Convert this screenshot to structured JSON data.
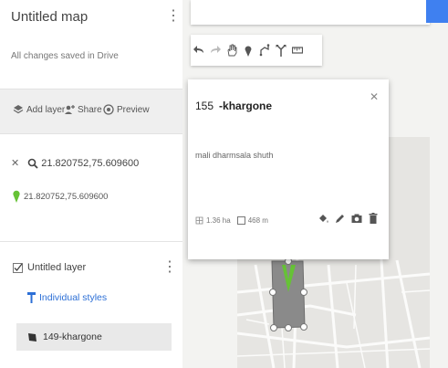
{
  "map": {
    "title": "Untitled map",
    "saved_status": "All changes saved in Drive"
  },
  "toolbar": {
    "add_layer": "Add layer",
    "share": "Share",
    "preview": "Preview"
  },
  "search_result": {
    "query": "21.820752,75.609600",
    "pin_label": "21.820752,75.609600"
  },
  "layer": {
    "title": "Untitled layer",
    "styles_link": "Individual styles",
    "feature": "149-khargone"
  },
  "info_card": {
    "number": "155",
    "name": "-khargone",
    "description": "mali dharmsala shuth",
    "area": "1.36 ha",
    "perimeter": "468 m"
  },
  "colors": {
    "accent": "#3f80f0",
    "link": "#2c6fd6",
    "pin": "#66c236",
    "polygon": "#8a8a8a"
  }
}
